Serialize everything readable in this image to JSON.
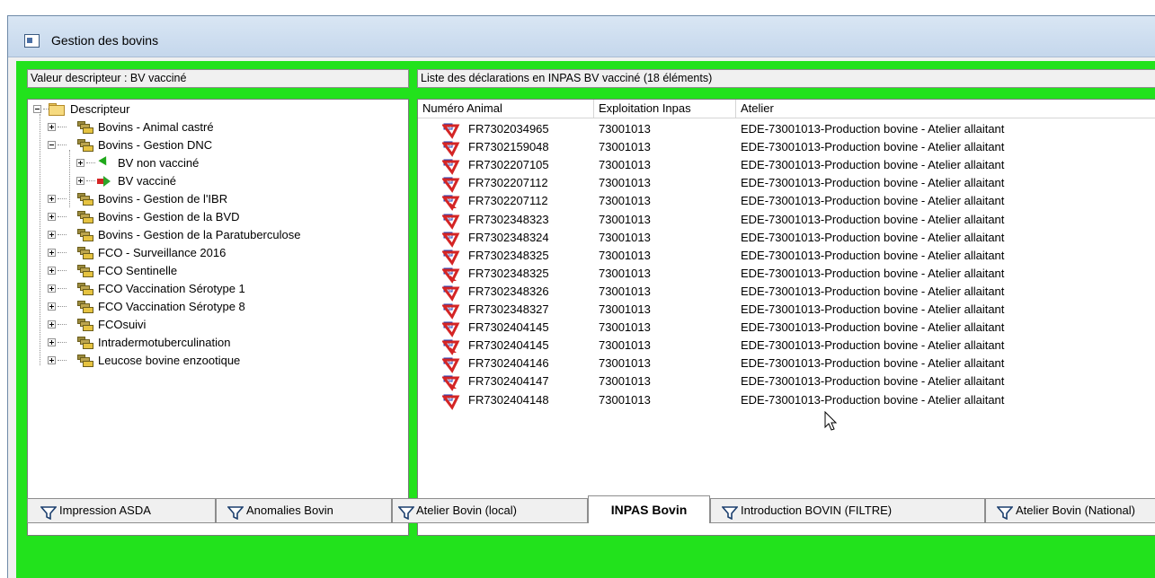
{
  "window": {
    "title": "Gestion des bovins"
  },
  "left_header": "Valeur descripteur : BV vacciné",
  "right_header": "Liste des déclarations en INPAS BV vacciné (18 éléments)",
  "tree": {
    "root": "Descripteur",
    "items": [
      {
        "label": "Bovins - Animal castré",
        "level": 1,
        "expander": "plus",
        "icon": "stack-icon"
      },
      {
        "label": "Bovins - Gestion DNC",
        "level": 1,
        "expander": "minus",
        "icon": "stack-icon"
      },
      {
        "label": "BV non vacciné",
        "level": 2,
        "expander": "plus",
        "icon": "green-triangle-icon"
      },
      {
        "label": "BV vacciné",
        "level": 2,
        "expander": "plus",
        "icon": "arrow-icon"
      },
      {
        "label": "Bovins - Gestion de l'IBR",
        "level": 1,
        "expander": "plus",
        "icon": "stack-icon"
      },
      {
        "label": "Bovins - Gestion de la BVD",
        "level": 1,
        "expander": "plus",
        "icon": "stack-icon"
      },
      {
        "label": "Bovins - Gestion de la Paratuberculose",
        "level": 1,
        "expander": "plus",
        "icon": "stack-icon"
      },
      {
        "label": "FCO - Surveillance 2016",
        "level": 1,
        "expander": "plus",
        "icon": "stack-icon"
      },
      {
        "label": "FCO Sentinelle",
        "level": 1,
        "expander": "plus",
        "icon": "stack-icon"
      },
      {
        "label": "FCO Vaccination Sérotype 1",
        "level": 1,
        "expander": "plus",
        "icon": "stack-icon"
      },
      {
        "label": "FCO Vaccination Sérotype 8",
        "level": 1,
        "expander": "plus",
        "icon": "stack-icon"
      },
      {
        "label": "FCOsuivi",
        "level": 1,
        "expander": "plus",
        "icon": "stack-icon"
      },
      {
        "label": "Intradermotuberculination",
        "level": 1,
        "expander": "plus",
        "icon": "stack-icon"
      },
      {
        "label": "Leucose bovine enzootique",
        "level": 1,
        "expander": "plus",
        "icon": "stack-icon"
      }
    ]
  },
  "list": {
    "columns": [
      "Numéro Animal",
      "Exploitation Inpas",
      "Atelier"
    ],
    "rows": [
      {
        "numero": "FR7302034965",
        "exploitation": "73001013",
        "atelier": "EDE-73001013-Production bovine - Atelier allaitant",
        "icon_variant": "normal"
      },
      {
        "numero": "FR7302159048",
        "exploitation": "73001013",
        "atelier": "EDE-73001013-Production bovine - Atelier allaitant",
        "icon_variant": "normal"
      },
      {
        "numero": "FR7302207105",
        "exploitation": "73001013",
        "atelier": "EDE-73001013-Production bovine - Atelier allaitant",
        "icon_variant": "normal"
      },
      {
        "numero": "FR7302207112",
        "exploitation": "73001013",
        "atelier": "EDE-73001013-Production bovine - Atelier allaitant",
        "icon_variant": "normal"
      },
      {
        "numero": "FR7302207112",
        "exploitation": "73001013",
        "atelier": "EDE-73001013-Production bovine - Atelier allaitant",
        "icon_variant": "flagged"
      },
      {
        "numero": "FR7302348323",
        "exploitation": "73001013",
        "atelier": "EDE-73001013-Production bovine - Atelier allaitant",
        "icon_variant": "normal"
      },
      {
        "numero": "FR7302348324",
        "exploitation": "73001013",
        "atelier": "EDE-73001013-Production bovine - Atelier allaitant",
        "icon_variant": "normal"
      },
      {
        "numero": "FR7302348325",
        "exploitation": "73001013",
        "atelier": "EDE-73001013-Production bovine - Atelier allaitant",
        "icon_variant": "normal"
      },
      {
        "numero": "FR7302348325",
        "exploitation": "73001013",
        "atelier": "EDE-73001013-Production bovine - Atelier allaitant",
        "icon_variant": "flagged"
      },
      {
        "numero": "FR7302348326",
        "exploitation": "73001013",
        "atelier": "EDE-73001013-Production bovine - Atelier allaitant",
        "icon_variant": "normal"
      },
      {
        "numero": "FR7302348327",
        "exploitation": "73001013",
        "atelier": "EDE-73001013-Production bovine - Atelier allaitant",
        "icon_variant": "normal"
      },
      {
        "numero": "FR7302404145",
        "exploitation": "73001013",
        "atelier": "EDE-73001013-Production bovine - Atelier allaitant",
        "icon_variant": "normal"
      },
      {
        "numero": "FR7302404145",
        "exploitation": "73001013",
        "atelier": "EDE-73001013-Production bovine - Atelier allaitant",
        "icon_variant": "flagged"
      },
      {
        "numero": "FR7302404146",
        "exploitation": "73001013",
        "atelier": "EDE-73001013-Production bovine - Atelier allaitant",
        "icon_variant": "normal"
      },
      {
        "numero": "FR7302404147",
        "exploitation": "73001013",
        "atelier": "EDE-73001013-Production bovine - Atelier allaitant",
        "icon_variant": "flagged"
      },
      {
        "numero": "FR7302404148",
        "exploitation": "73001013",
        "atelier": "EDE-73001013-Production bovine - Atelier allaitant",
        "icon_variant": "normal"
      }
    ]
  },
  "tabs": [
    {
      "label": "Impression ASDA",
      "icon": "funnel-icon",
      "active": false
    },
    {
      "label": "Anomalies Bovin",
      "icon": "funnel-icon",
      "active": false
    },
    {
      "label": "Atelier Bovin (local)",
      "icon": "funnel-icon",
      "active": false
    },
    {
      "label": "INPAS Bovin",
      "icon": "",
      "active": true
    },
    {
      "label": "Introduction BOVIN (FILTRE)",
      "icon": "funnel-icon",
      "active": false
    },
    {
      "label": "Atelier Bovin (National)",
      "icon": "funnel-icon",
      "active": false
    }
  ],
  "colors": {
    "frame_green": "#22e21c",
    "titlebar": "#c9dbef",
    "icon_red": "#d42525",
    "icon_blue": "#1f3fb8"
  }
}
